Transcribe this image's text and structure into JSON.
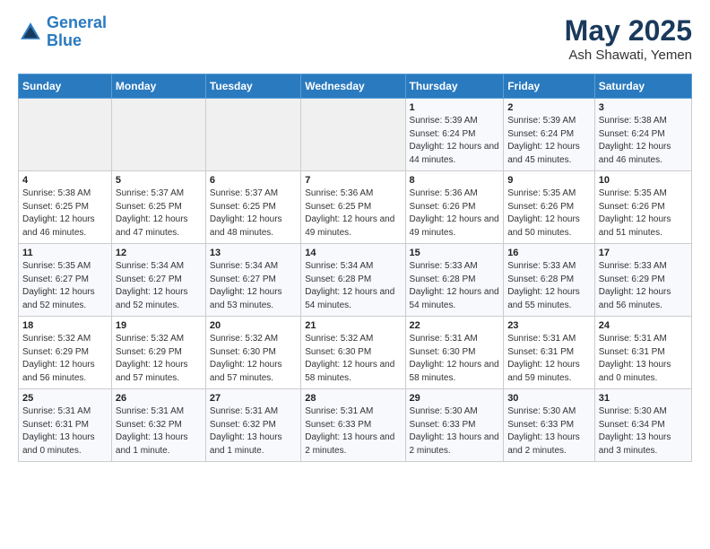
{
  "header": {
    "logo_line1": "General",
    "logo_line2": "Blue",
    "main_title": "May 2025",
    "subtitle": "Ash Shawati, Yemen"
  },
  "days_of_week": [
    "Sunday",
    "Monday",
    "Tuesday",
    "Wednesday",
    "Thursday",
    "Friday",
    "Saturday"
  ],
  "weeks": [
    [
      {
        "day": "",
        "empty": true
      },
      {
        "day": "",
        "empty": true
      },
      {
        "day": "",
        "empty": true
      },
      {
        "day": "",
        "empty": true
      },
      {
        "day": "1",
        "sunrise": "5:39 AM",
        "sunset": "6:24 PM",
        "daylight": "12 hours and 44 minutes."
      },
      {
        "day": "2",
        "sunrise": "5:39 AM",
        "sunset": "6:24 PM",
        "daylight": "12 hours and 45 minutes."
      },
      {
        "day": "3",
        "sunrise": "5:38 AM",
        "sunset": "6:24 PM",
        "daylight": "12 hours and 46 minutes."
      }
    ],
    [
      {
        "day": "4",
        "sunrise": "5:38 AM",
        "sunset": "6:25 PM",
        "daylight": "12 hours and 46 minutes."
      },
      {
        "day": "5",
        "sunrise": "5:37 AM",
        "sunset": "6:25 PM",
        "daylight": "12 hours and 47 minutes."
      },
      {
        "day": "6",
        "sunrise": "5:37 AM",
        "sunset": "6:25 PM",
        "daylight": "12 hours and 48 minutes."
      },
      {
        "day": "7",
        "sunrise": "5:36 AM",
        "sunset": "6:25 PM",
        "daylight": "12 hours and 49 minutes."
      },
      {
        "day": "8",
        "sunrise": "5:36 AM",
        "sunset": "6:26 PM",
        "daylight": "12 hours and 49 minutes."
      },
      {
        "day": "9",
        "sunrise": "5:35 AM",
        "sunset": "6:26 PM",
        "daylight": "12 hours and 50 minutes."
      },
      {
        "day": "10",
        "sunrise": "5:35 AM",
        "sunset": "6:26 PM",
        "daylight": "12 hours and 51 minutes."
      }
    ],
    [
      {
        "day": "11",
        "sunrise": "5:35 AM",
        "sunset": "6:27 PM",
        "daylight": "12 hours and 52 minutes."
      },
      {
        "day": "12",
        "sunrise": "5:34 AM",
        "sunset": "6:27 PM",
        "daylight": "12 hours and 52 minutes."
      },
      {
        "day": "13",
        "sunrise": "5:34 AM",
        "sunset": "6:27 PM",
        "daylight": "12 hours and 53 minutes."
      },
      {
        "day": "14",
        "sunrise": "5:34 AM",
        "sunset": "6:28 PM",
        "daylight": "12 hours and 54 minutes."
      },
      {
        "day": "15",
        "sunrise": "5:33 AM",
        "sunset": "6:28 PM",
        "daylight": "12 hours and 54 minutes."
      },
      {
        "day": "16",
        "sunrise": "5:33 AM",
        "sunset": "6:28 PM",
        "daylight": "12 hours and 55 minutes."
      },
      {
        "day": "17",
        "sunrise": "5:33 AM",
        "sunset": "6:29 PM",
        "daylight": "12 hours and 56 minutes."
      }
    ],
    [
      {
        "day": "18",
        "sunrise": "5:32 AM",
        "sunset": "6:29 PM",
        "daylight": "12 hours and 56 minutes."
      },
      {
        "day": "19",
        "sunrise": "5:32 AM",
        "sunset": "6:29 PM",
        "daylight": "12 hours and 57 minutes."
      },
      {
        "day": "20",
        "sunrise": "5:32 AM",
        "sunset": "6:30 PM",
        "daylight": "12 hours and 57 minutes."
      },
      {
        "day": "21",
        "sunrise": "5:32 AM",
        "sunset": "6:30 PM",
        "daylight": "12 hours and 58 minutes."
      },
      {
        "day": "22",
        "sunrise": "5:31 AM",
        "sunset": "6:30 PM",
        "daylight": "12 hours and 58 minutes."
      },
      {
        "day": "23",
        "sunrise": "5:31 AM",
        "sunset": "6:31 PM",
        "daylight": "12 hours and 59 minutes."
      },
      {
        "day": "24",
        "sunrise": "5:31 AM",
        "sunset": "6:31 PM",
        "daylight": "13 hours and 0 minutes."
      }
    ],
    [
      {
        "day": "25",
        "sunrise": "5:31 AM",
        "sunset": "6:31 PM",
        "daylight": "13 hours and 0 minutes."
      },
      {
        "day": "26",
        "sunrise": "5:31 AM",
        "sunset": "6:32 PM",
        "daylight": "13 hours and 1 minute."
      },
      {
        "day": "27",
        "sunrise": "5:31 AM",
        "sunset": "6:32 PM",
        "daylight": "13 hours and 1 minute."
      },
      {
        "day": "28",
        "sunrise": "5:31 AM",
        "sunset": "6:33 PM",
        "daylight": "13 hours and 2 minutes."
      },
      {
        "day": "29",
        "sunrise": "5:30 AM",
        "sunset": "6:33 PM",
        "daylight": "13 hours and 2 minutes."
      },
      {
        "day": "30",
        "sunrise": "5:30 AM",
        "sunset": "6:33 PM",
        "daylight": "13 hours and 2 minutes."
      },
      {
        "day": "31",
        "sunrise": "5:30 AM",
        "sunset": "6:34 PM",
        "daylight": "13 hours and 3 minutes."
      }
    ]
  ],
  "labels": {
    "sunrise_label": "Sunrise:",
    "sunset_label": "Sunset:",
    "daylight_label": "Daylight:"
  }
}
